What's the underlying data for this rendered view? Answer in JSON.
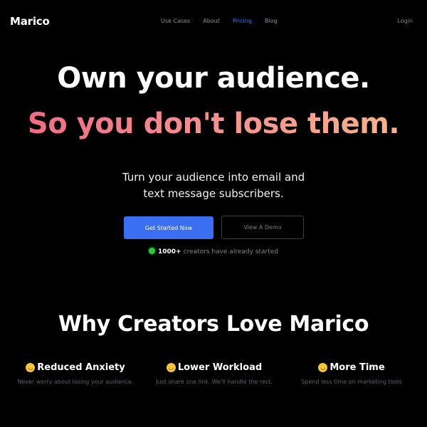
{
  "nav": {
    "logo": "Marico",
    "links": [
      "Use Cases",
      "About",
      "Pricing",
      "Blog"
    ],
    "active": "Pricing",
    "login": "Login",
    "active_color": "#3f78ef"
  },
  "hero": {
    "line1": "Own your audience.",
    "line2": "So you don't lose them.",
    "subtitle_line1": "Turn your audience into email and",
    "subtitle_line2": "text message subscribers.",
    "gradient_colors": [
      "#f26c82",
      "#f8b489"
    ]
  },
  "buttons": {
    "primary": "Get Started Now",
    "secondary": "View A Demo",
    "primary_color": "#3a6ff2"
  },
  "social_proof": {
    "count": "1000+",
    "text": "creators have already started",
    "indicator_color": "#27c93f"
  },
  "why": {
    "title": "Why Creators Love Marico",
    "features": [
      {
        "icon": "winking-face-emoji",
        "emoji": "😉",
        "title": "Reduced Anxiety",
        "desc": "Never worry about losing your audience."
      },
      {
        "icon": "grinning-face-emoji",
        "emoji": "😁",
        "title": "Lower Workload",
        "desc": "Just share one link. We'll handle the rest."
      },
      {
        "icon": "grinning-face-emoji",
        "emoji": "😁",
        "title": "More Time",
        "desc": "Spend less time on marketing tools"
      }
    ]
  }
}
